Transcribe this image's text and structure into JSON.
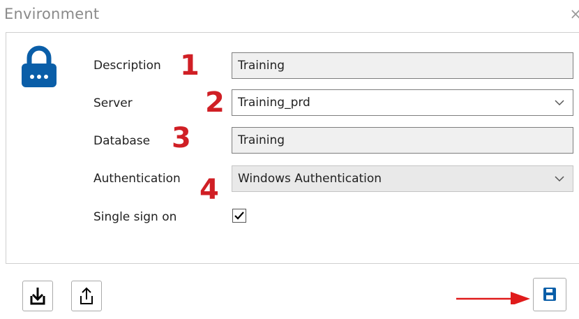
{
  "dialog": {
    "title": "Environment",
    "close_glyph": "×"
  },
  "form": {
    "description": {
      "label": "Description",
      "value": "Training",
      "marker": "1"
    },
    "server": {
      "label": "Server",
      "value": "Training_prd",
      "marker": "2"
    },
    "database": {
      "label": "Database",
      "value": "Training",
      "marker": "3"
    },
    "authentication": {
      "label": "Authentication",
      "value": "Windows Authentication",
      "marker": "4"
    },
    "single_sign_on": {
      "label": "Single sign on",
      "checked": true
    }
  },
  "icons": {
    "lock": "lock-icon",
    "import": "import-icon",
    "export": "export-icon",
    "save": "save-icon"
  },
  "colors": {
    "accent_blue": "#0a5ea8",
    "annotation_red": "#d01f25"
  }
}
